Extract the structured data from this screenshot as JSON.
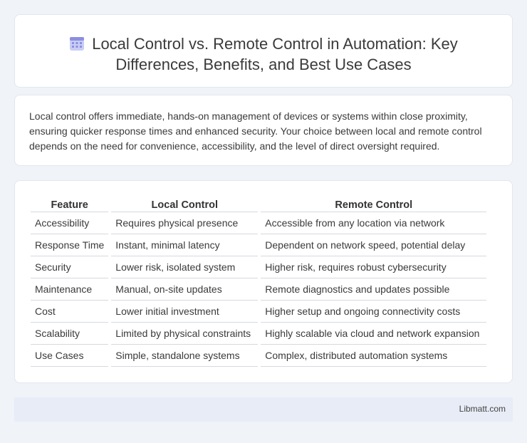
{
  "header": {
    "title_line1": "Local Control vs. Remote Control in Automation: Key",
    "title_line2": "Differences, Benefits, and Best Use Cases",
    "icon": "calendar-grid-icon"
  },
  "intro": {
    "text": "Local control offers immediate, hands-on management of devices or systems within close proximity, ensuring quicker response times and enhanced security. Your choice between local and remote control depends on the need for convenience, accessibility, and the level of direct oversight required."
  },
  "table": {
    "headers": [
      "Feature",
      "Local Control",
      "Remote Control"
    ],
    "rows": [
      [
        "Accessibility",
        "Requires physical presence",
        "Accessible from any location via network"
      ],
      [
        "Response Time",
        "Instant, minimal latency",
        "Dependent on network speed, potential delay"
      ],
      [
        "Security",
        "Lower risk, isolated system",
        "Higher risk, requires robust cybersecurity"
      ],
      [
        "Maintenance",
        "Manual, on-site updates",
        "Remote diagnostics and updates possible"
      ],
      [
        "Cost",
        "Lower initial investment",
        "Higher setup and ongoing connectivity costs"
      ],
      [
        "Scalability",
        "Limited by physical constraints",
        "Highly scalable via cloud and network expansion"
      ],
      [
        "Use Cases",
        "Simple, standalone systems",
        "Complex, distributed automation systems"
      ]
    ]
  },
  "footer": {
    "brand": "Libmatt.com"
  },
  "colors": {
    "background": "#f0f3f8",
    "card": "#ffffff",
    "footer": "#e7ecf6",
    "icon_accent": "#8b8fe0"
  }
}
